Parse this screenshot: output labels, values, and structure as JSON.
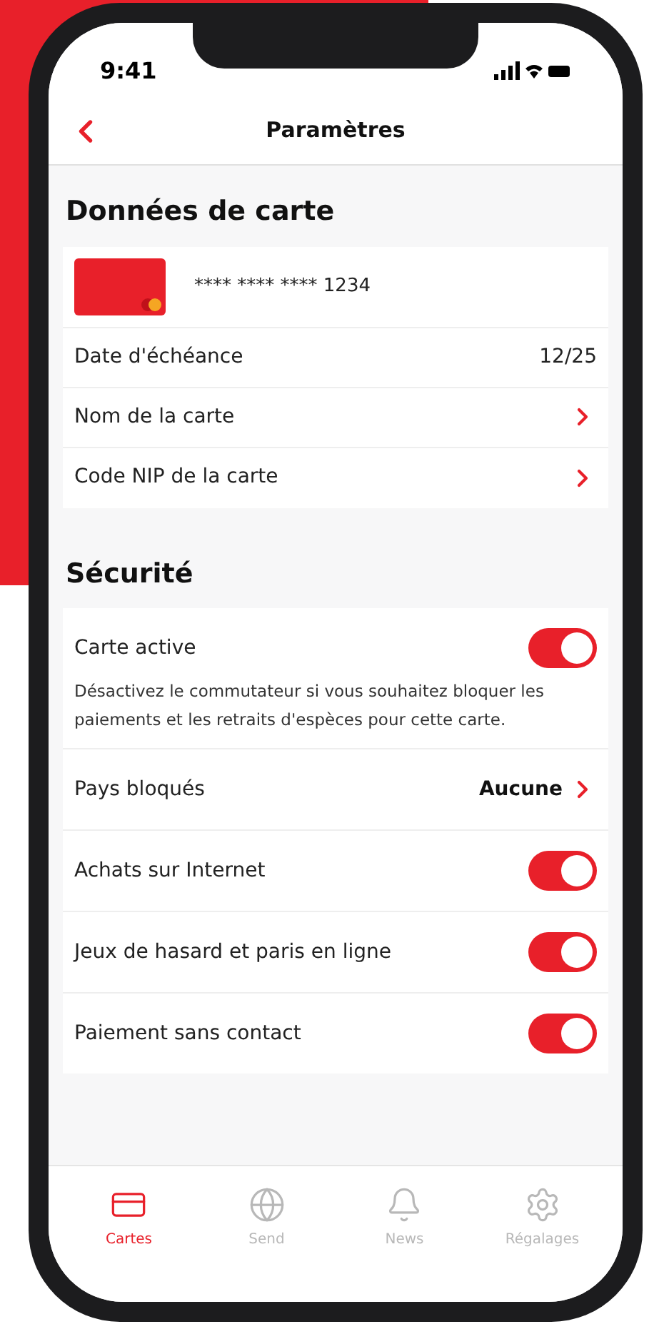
{
  "status_bar": {
    "time": "9:41"
  },
  "header": {
    "title": "Paramètres"
  },
  "card_section": {
    "title": "Données de carte",
    "card_number": "**** **** **** 1234",
    "rows": [
      {
        "kind": "value",
        "label": "Date d'échéance",
        "value": "12/25"
      },
      {
        "kind": "link",
        "label": "Nom de la carte"
      },
      {
        "kind": "link",
        "label": "Code NIP de la carte"
      }
    ]
  },
  "security_section": {
    "title": "Sécurité",
    "rows": [
      {
        "kind": "toggle",
        "label": "Carte active",
        "on": true,
        "note": "Désactivez le commutateur si vous souhaitez bloquer les paiements et les retraits d'espèces pour cette carte."
      },
      {
        "kind": "link",
        "label": "Pays bloqués",
        "value": "Aucune"
      },
      {
        "kind": "toggle",
        "label": "Achats sur Internet",
        "on": true
      },
      {
        "kind": "toggle",
        "label": "Jeux de hasard et paris en ligne",
        "on": true
      },
      {
        "kind": "toggle",
        "label": "Paiement sans contact",
        "on": true
      }
    ]
  },
  "tab_bar": [
    {
      "kind": "card",
      "label": "Cartes",
      "selected": true
    },
    {
      "kind": "globe",
      "label": "Send",
      "selected": false
    },
    {
      "kind": "bell",
      "label": "News",
      "selected": false
    },
    {
      "kind": "gear",
      "label": "Régalages",
      "selected": false
    }
  ]
}
